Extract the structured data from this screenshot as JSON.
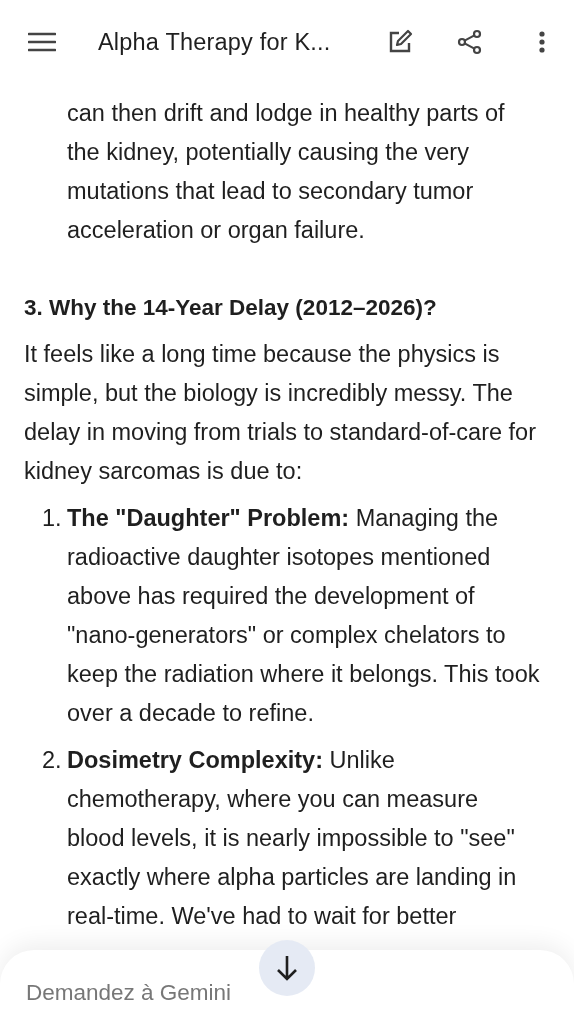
{
  "top_bar": {
    "title": "Alpha Therapy for K..."
  },
  "content": {
    "continuation": "can then drift and lodge in healthy parts of the kidney, potentially causing the very mutations that lead to secondary tumor acceleration or organ failure.",
    "heading": "3. Why the 14-Year Delay (2012–2026)?",
    "paragraph": "It feels like a long time because the physics is simple, but the biology is incredibly messy. The delay in moving from trials to standard-of-care for kidney sarcomas is due to:",
    "list": [
      {
        "number": "1.",
        "text": "**The \"Daughter\" Problem:** Managing the radioactive daughter isotopes mentioned above has required the development of \"nano-generators\" or complex chelators to keep the radiation where it belongs. This took over a decade to refine."
      },
      {
        "number": "2.",
        "text": "**Dosimetry Complexity:** Unlike chemotherapy, where you can measure blood levels, it is nearly impossible to \"see\" exactly where alpha particles are landing in real-time. We've had to wait for better"
      }
    ]
  },
  "composer": {
    "placeholder": "Demandez à Gemini"
  }
}
